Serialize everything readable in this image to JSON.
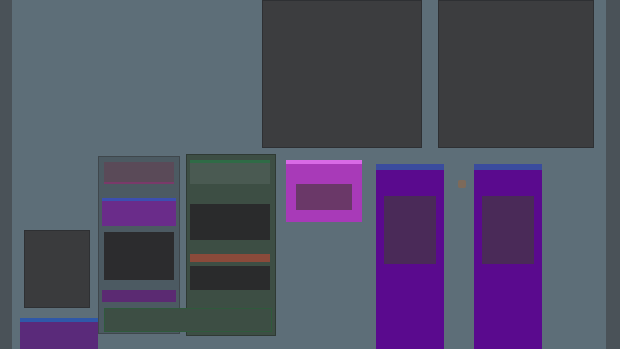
{
  "window": {
    "background": "#5d6e78"
  },
  "viewports": [
    {
      "id": "viewport-left"
    },
    {
      "id": "viewport-right"
    }
  ],
  "colors": {
    "panel_dark": "#2f3133",
    "purple_column": "#5a0a8e",
    "pink_card": "#a83ab8",
    "green_panel": "#3d4e44"
  }
}
